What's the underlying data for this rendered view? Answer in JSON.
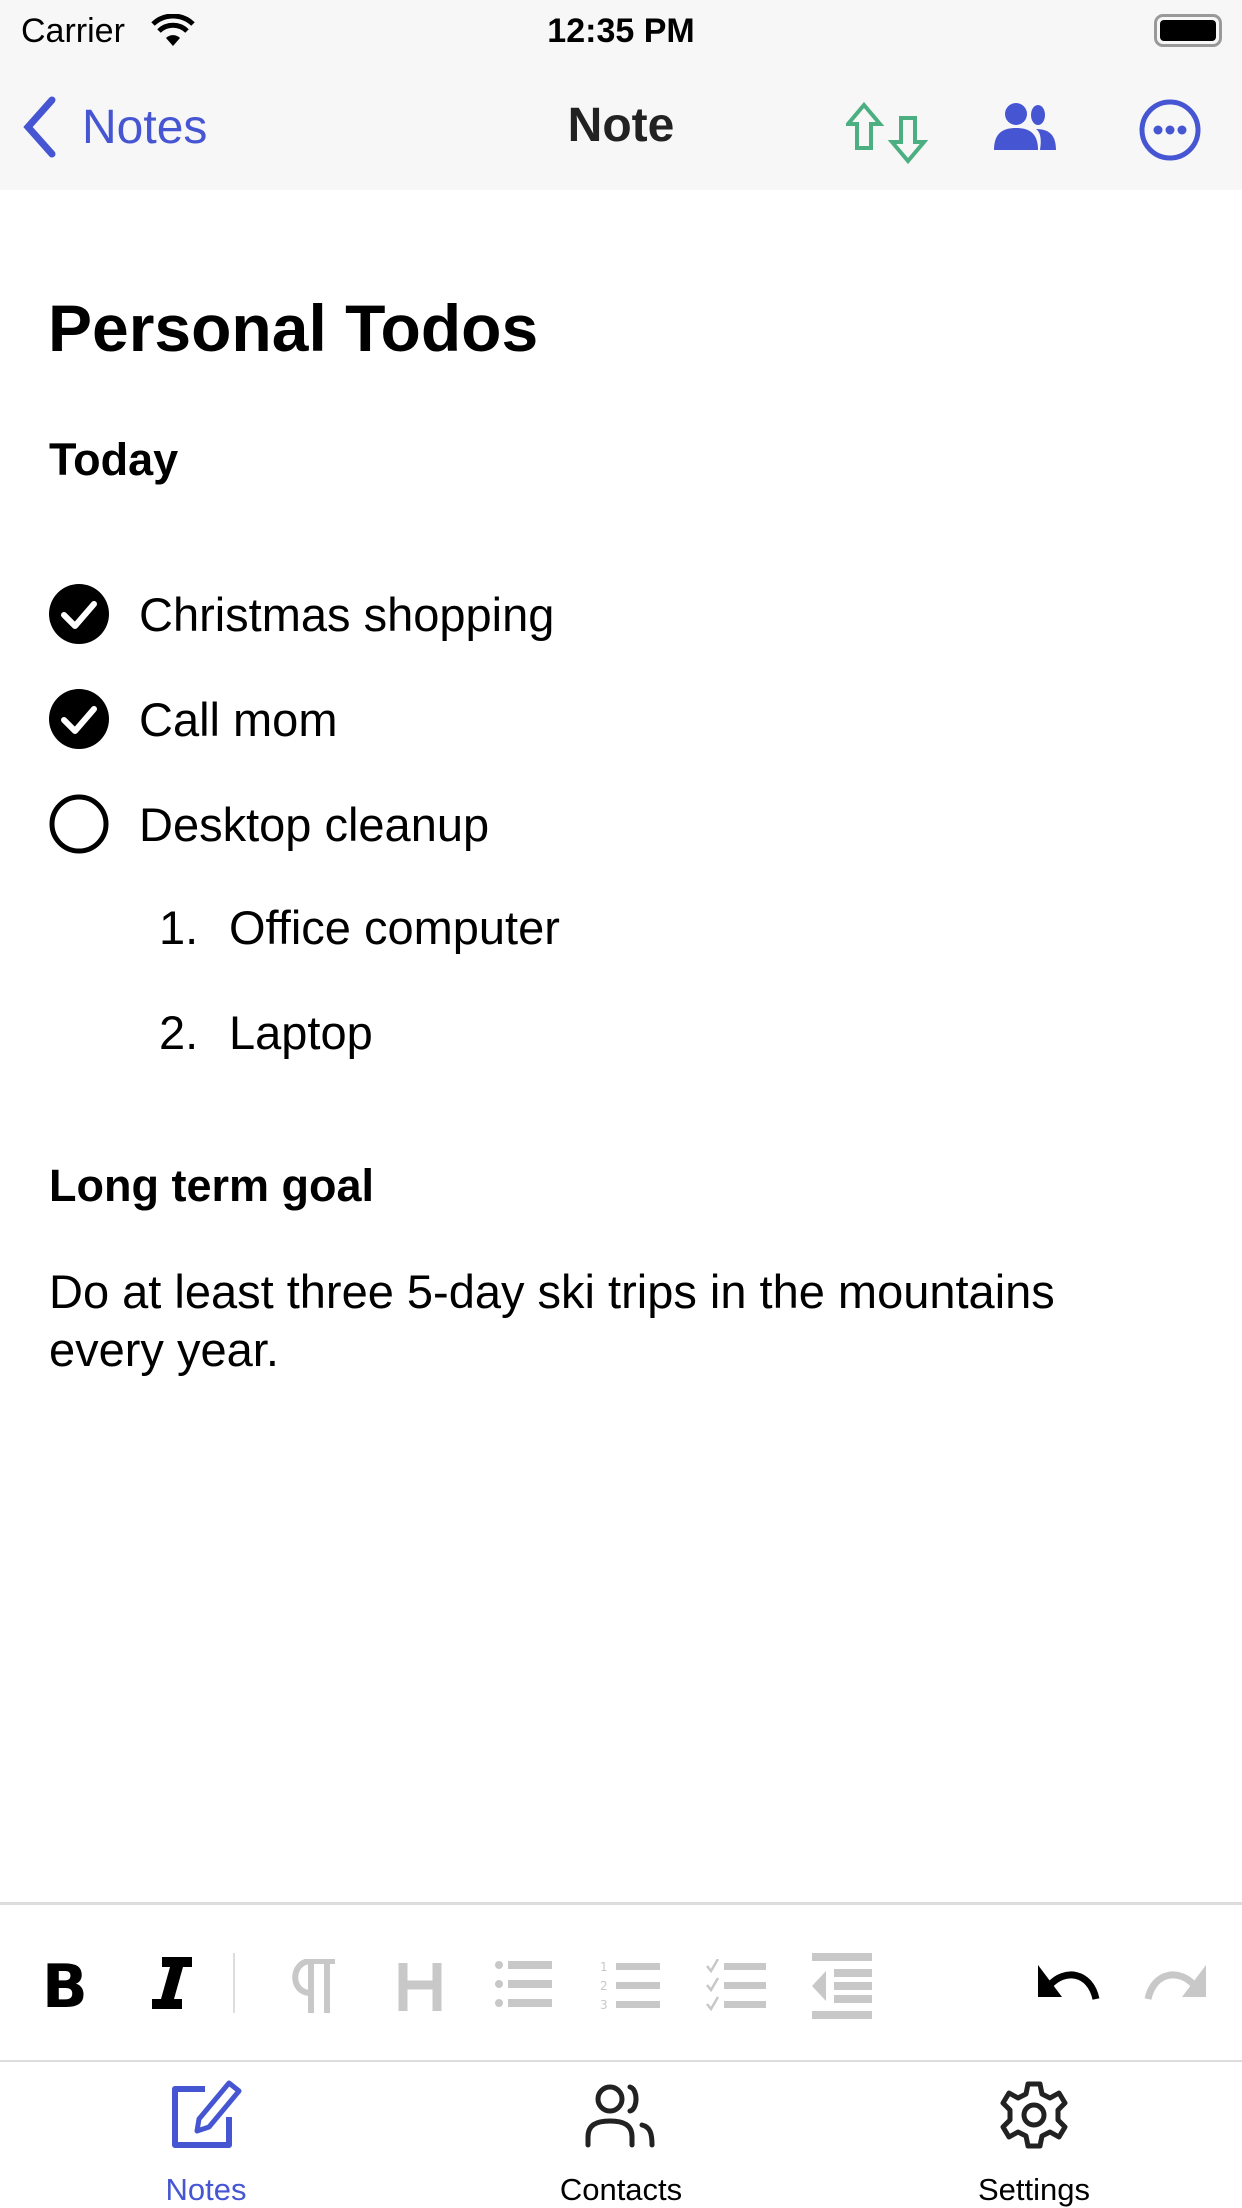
{
  "status_bar": {
    "carrier": "Carrier",
    "time": "12:35 PM"
  },
  "nav": {
    "back_label": "Notes",
    "title": "Note"
  },
  "note": {
    "title": "Personal Todos",
    "section1": "Today",
    "checklist": [
      {
        "text": "Christmas shopping",
        "checked": true
      },
      {
        "text": "Call mom",
        "checked": true
      },
      {
        "text": "Desktop cleanup",
        "checked": false
      }
    ],
    "numbered": [
      {
        "num": "1.",
        "text": "Office computer"
      },
      {
        "num": "2.",
        "text": "Laptop"
      }
    ],
    "section2": "Long term goal",
    "paragraph_line1": "Do at least three 5-day ski trips in the mountains",
    "paragraph_line2": "every year."
  },
  "tabs": [
    {
      "label": "Notes",
      "active": true
    },
    {
      "label": "Contacts",
      "active": false
    },
    {
      "label": "Settings",
      "active": false
    }
  ],
  "colors": {
    "accent": "#4656d2",
    "sync": "#4caf82",
    "disabled": "#c8c8c8"
  }
}
